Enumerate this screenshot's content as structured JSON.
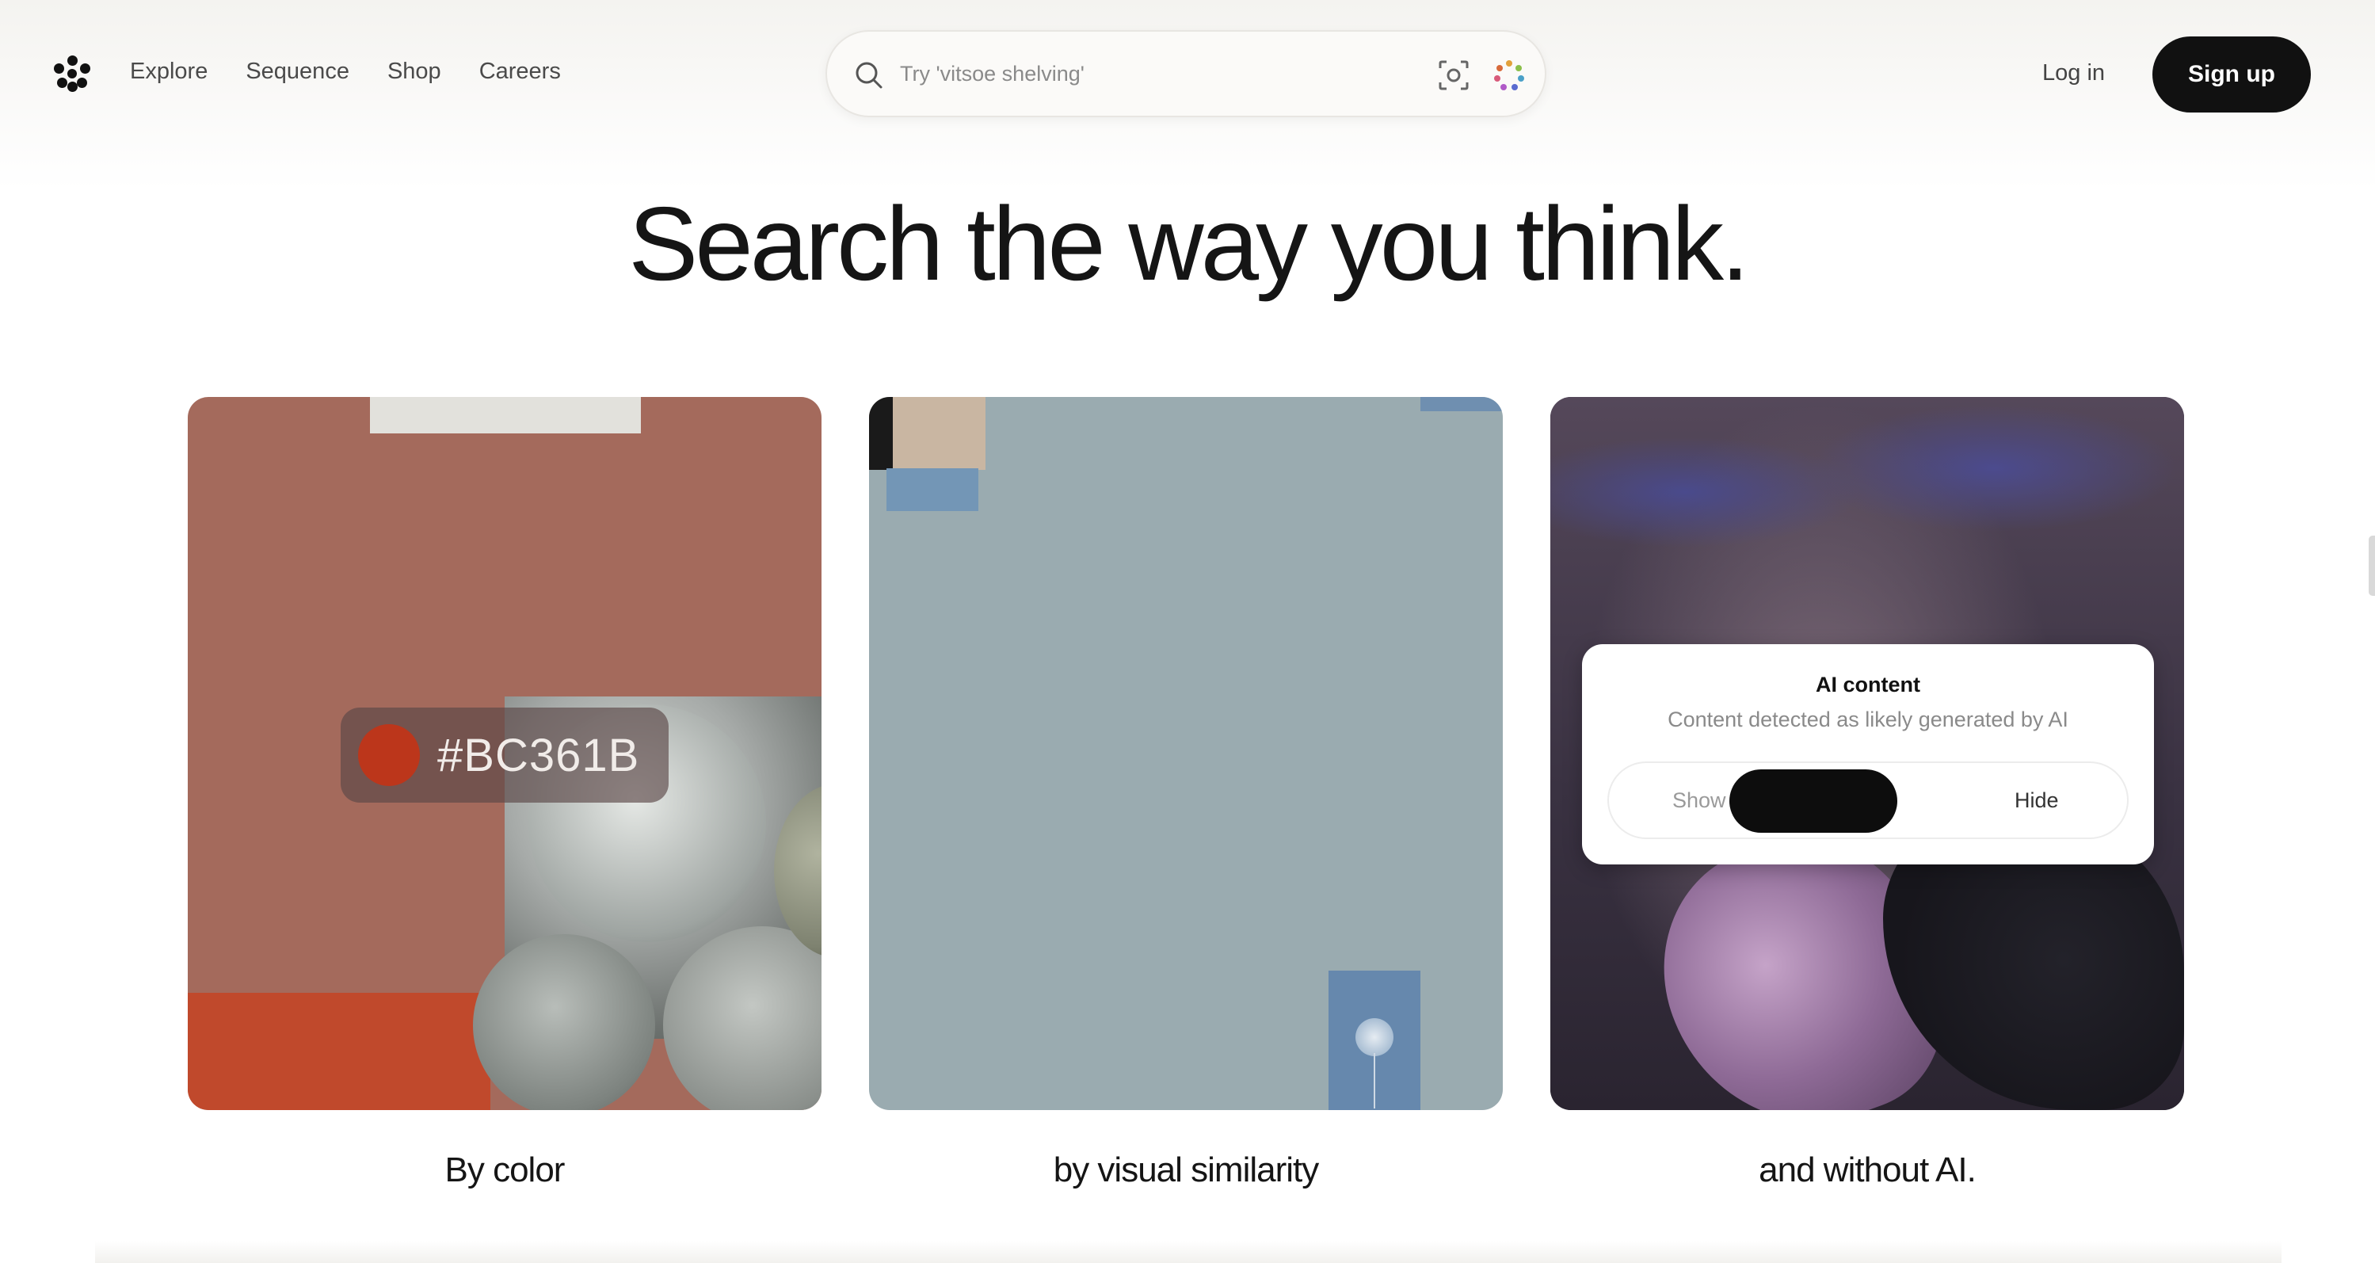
{
  "header": {
    "logo": "dot-flower-logo",
    "nav": [
      "Explore",
      "Sequence",
      "Shop",
      "Careers"
    ],
    "search": {
      "placeholder": "Try 'vitsoe shelving'",
      "icons": [
        "search-icon",
        "visual-search-icon",
        "color-search-icon"
      ]
    },
    "login_label": "Log in",
    "signup_label": "Sign up"
  },
  "hero": {
    "title": "Search the way you think."
  },
  "cards": [
    {
      "caption": "By color",
      "color_hex": "#BC361B"
    },
    {
      "caption": "by visual similarity"
    },
    {
      "caption": "and without AI.",
      "modal": {
        "title": "AI content",
        "subtitle": "Content detected as likely generated by AI",
        "show_label": "Show",
        "hide_label": "Hide"
      }
    }
  ],
  "colors": {
    "accent_swatch": "#bc361b",
    "button_bg": "#111111",
    "card1_bg": "#a46a5c",
    "card2_bg": "#9aabb0"
  }
}
